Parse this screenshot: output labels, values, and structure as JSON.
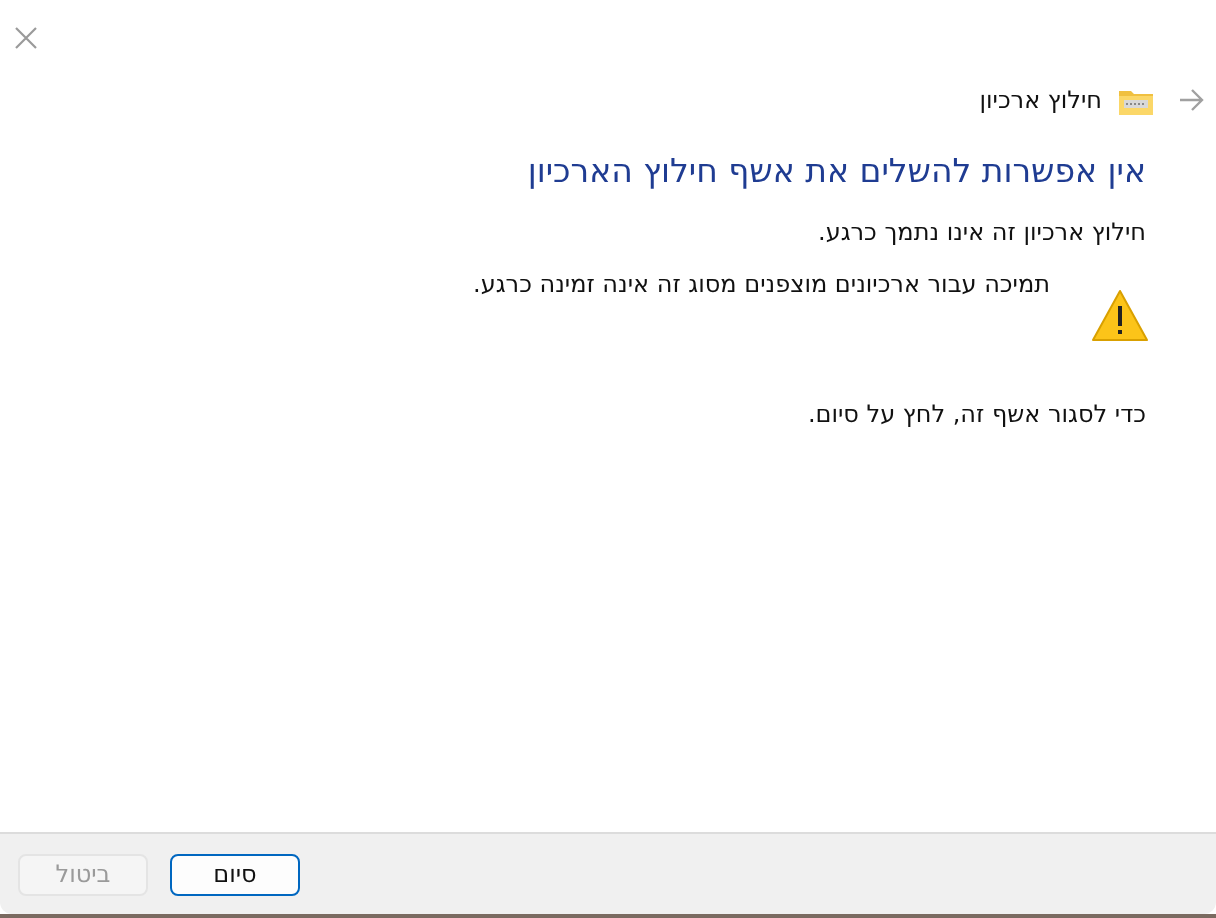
{
  "header": {
    "title": "חילוץ ארכיון"
  },
  "heading": "אין אפשרות להשלים את אשף חילוץ הארכיון",
  "messages": [
    {
      "kind": "text",
      "text": "חילוץ ארכיון זה אינו נתמך כרגע."
    },
    {
      "kind": "warning",
      "text": "תמיכה עבור ארכיונים מוצפנים מסוג זה אינה זמינה כרגע."
    },
    {
      "kind": "text",
      "text": "כדי לסגור אשף זה, לחץ על סיום."
    }
  ],
  "buttons": [
    {
      "label": "סיום",
      "default": true,
      "disabled": false
    },
    {
      "label": "ביטול",
      "default": false,
      "disabled": true
    }
  ]
}
